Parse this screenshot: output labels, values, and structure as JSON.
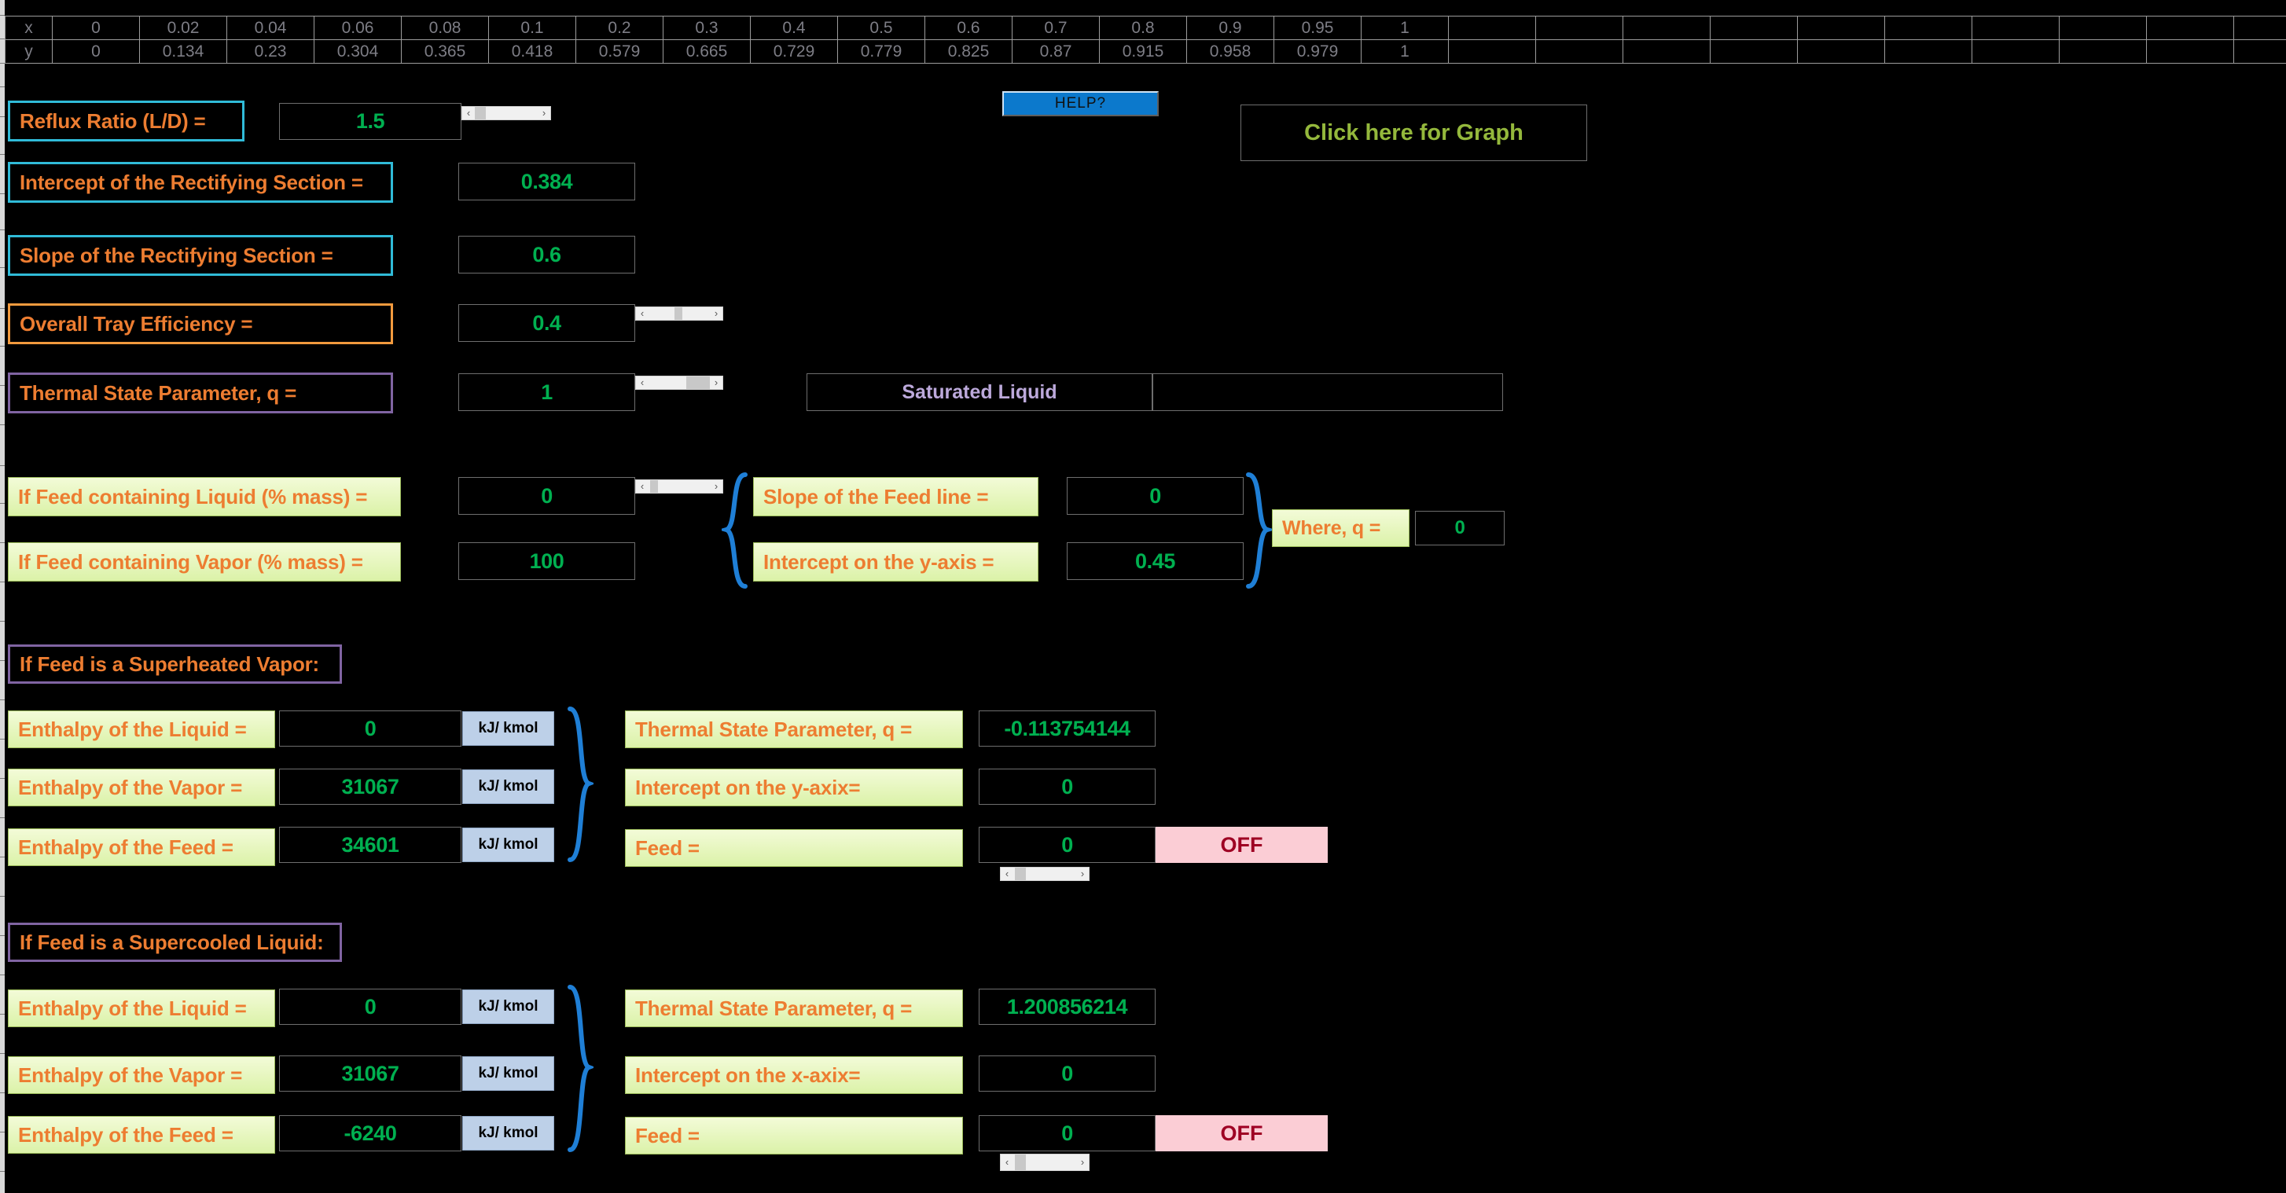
{
  "chart_data": {
    "type": "table",
    "title": "Equilibrium x-y data",
    "row_labels": [
      "x",
      "y"
    ],
    "x": [
      0,
      0.02,
      0.04,
      0.06,
      0.08,
      0.1,
      0.2,
      0.3,
      0.4,
      0.5,
      0.6,
      0.7,
      0.8,
      0.9,
      0.95,
      1
    ],
    "y": [
      0,
      0.134,
      0.23,
      0.304,
      0.365,
      0.418,
      0.579,
      0.665,
      0.729,
      0.779,
      0.825,
      0.87,
      0.915,
      0.958,
      0.979,
      1
    ],
    "x_display": [
      "0",
      "0.02",
      "0.04",
      "0.06",
      "0.08",
      "0.1",
      "0.2",
      "0.3",
      "0.4",
      "0.5",
      "0.6",
      "0.7",
      "0.8",
      "0.9",
      "0.95",
      "1"
    ],
    "y_display": [
      "0",
      "0.134",
      "0.23",
      "0.304",
      "0.365",
      "0.418",
      "0.579",
      "0.665",
      "0.729",
      "0.779",
      "0.825",
      "0.87",
      "0.915",
      "0.958",
      "0.979",
      "1"
    ],
    "empty_trailing_columns": 10
  },
  "colors": {
    "label_text": "#ED7D31",
    "value_text": "#00B050",
    "cyan_border": "#30BBD8",
    "orange_border": "#F29A3E",
    "purple_border": "#8064A2",
    "green_fill": "#DBF2A8",
    "unit_fill": "#BDD0E8",
    "off_fill": "#FBCDD5",
    "off_text": "#9E0023",
    "help_fill": "#0C79CC",
    "graph_text": "#94B83C",
    "sat_text": "#BCA9DB",
    "background": "#000000"
  },
  "buttons": {
    "help": "HELP?",
    "graph": "Click here for Graph"
  },
  "rectifying": {
    "reflux_label": "Reflux Ratio (L/D) =",
    "reflux_value": "1.5",
    "intercept_label": "Intercept of the Rectifying Section =",
    "intercept_value": "0.384",
    "slope_label": "Slope of the Rectifying Section =",
    "slope_value": "0.6"
  },
  "efficiency": {
    "label": "Overall Tray Efficiency =",
    "value": "0.4"
  },
  "thermal_state": {
    "label": "Thermal State Parameter, q =",
    "value": "1",
    "state_text": "Saturated Liquid"
  },
  "feed_fractions": {
    "liquid_label": "If Feed containing Liquid (% mass) =",
    "liquid_value": "0",
    "vapor_label": "If Feed containing Vapor (% mass) =",
    "vapor_value": "100",
    "slope_label": "Slope of the Feed line =",
    "slope_value": "0",
    "intercept_label": "Intercept on the y-axis =",
    "intercept_value": "0.45",
    "where_label": "Where, q =",
    "where_value": "0"
  },
  "superheated": {
    "heading": "If Feed is a Superheated Vapor:",
    "enthalpy_liquid_label": "Enthalpy of the Liquid =",
    "enthalpy_liquid_value": "0",
    "enthalpy_vapor_label": "Enthalpy of the Vapor =",
    "enthalpy_vapor_value": "31067",
    "enthalpy_feed_label": "Enthalpy of the Feed =",
    "enthalpy_feed_value": "34601",
    "unit": "kJ/ kmol",
    "q_label": "Thermal State Parameter, q =",
    "q_value": "-0.113754144",
    "intercept_label": "Intercept on the y-axix=",
    "intercept_value": "0",
    "feed_label": "Feed =",
    "feed_value": "0",
    "toggle_state": "OFF"
  },
  "supercooled": {
    "heading": "If Feed is a Supercooled Liquid:",
    "enthalpy_liquid_label": "Enthalpy of the Liquid =",
    "enthalpy_liquid_value": "0",
    "enthalpy_vapor_label": "Enthalpy of the Vapor =",
    "enthalpy_vapor_value": "31067",
    "enthalpy_feed_label": "Enthalpy of the Feed =",
    "enthalpy_feed_value": "-6240",
    "unit": "kJ/ kmol",
    "q_label": "Thermal State Parameter, q =",
    "q_value": "1.200856214",
    "intercept_label": "Intercept on the x-axix=",
    "intercept_value": "0",
    "feed_label": "Feed =",
    "feed_value": "0",
    "toggle_state": "OFF"
  },
  "scrollbars": {
    "left_arrow": "‹",
    "right_arrow": "›"
  }
}
